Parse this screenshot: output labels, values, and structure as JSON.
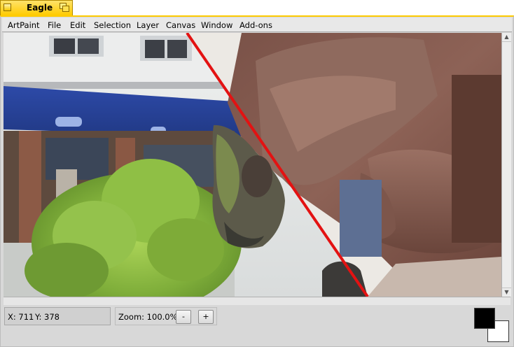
{
  "window": {
    "title": "Eagle"
  },
  "menu": {
    "items": [
      {
        "label": "ArtPaint"
      },
      {
        "label": "File"
      },
      {
        "label": "Edit"
      },
      {
        "label": "Selection"
      },
      {
        "label": "Layer"
      },
      {
        "label": "Canvas"
      },
      {
        "label": "Window"
      },
      {
        "label": "Add-ons"
      }
    ]
  },
  "status": {
    "x_label": "X: 711",
    "y_label": "Y: 378",
    "zoom_label": "Zoom: 100.0%",
    "zoom_out_label": "-",
    "zoom_in_label": "+"
  },
  "colors": {
    "tab": "#ffcb00",
    "foreground_color": "#000000",
    "background_color": "#ffffff",
    "stroke_line": "#e31212"
  },
  "canvas": {
    "content": "photo-image"
  }
}
